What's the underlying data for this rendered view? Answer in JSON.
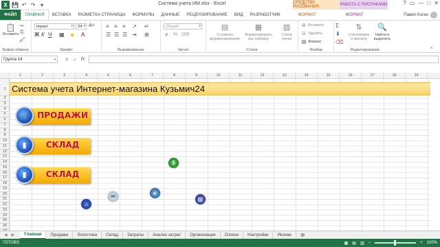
{
  "window": {
    "title": "Система учета ИМ.xlsx - Excel",
    "ctx_drawing": "СРЕДСТВА РИСОВАНИЯ",
    "ctx_picture": "РАБОТА С РИСУНКАМИ",
    "controls": [
      "?",
      "▭",
      "—",
      "□",
      "✕"
    ]
  },
  "tabs": [
    {
      "label": "ФАЙЛ"
    },
    {
      "label": "ГЛАВНАЯ"
    },
    {
      "label": "ВСТАВКА"
    },
    {
      "label": "РАЗМЕТКА СТРАНИЦЫ"
    },
    {
      "label": "ФОРМУЛЫ"
    },
    {
      "label": "ДАННЫЕ"
    },
    {
      "label": "РЕЦЕНЗИРОВАНИЕ"
    },
    {
      "label": "ВИД"
    },
    {
      "label": "РАЗРАБОТЧИК"
    },
    {
      "label": "ФОРМАТ"
    },
    {
      "label": "ФОРМАТ"
    }
  ],
  "user": "Павел Коган",
  "ribbon": {
    "clipboard": {
      "label": "Буфер обмена",
      "paste": "Вставить"
    },
    "font": {
      "label": "Шрифт",
      "name": "Impact",
      "size": "24"
    },
    "alignment": {
      "label": "Выравнивание"
    },
    "number": {
      "label": "Число",
      "format": "Общий"
    },
    "styles": {
      "label": "Стили",
      "cond": "Условное форматирование",
      "astable": "Форматировать как таблицу",
      "cellstyles": "Стили ячеек"
    },
    "cells": {
      "label": "Ячейки",
      "insert": "Вставить",
      "delete": "Удалить",
      "format": "Формат"
    },
    "editing": {
      "label": "Редактирование",
      "sort": "Сортировка и фильтр",
      "find": "Найти и выделить"
    }
  },
  "formula_bar": {
    "namebox": "Группа 14",
    "fx": "fx",
    "value": ""
  },
  "columns": [
    "1",
    "2",
    "3",
    "4",
    "5",
    "6",
    "7",
    "8",
    "9",
    "10",
    "11",
    "12",
    "13",
    "14",
    "15",
    "16",
    "17",
    "18",
    "19"
  ],
  "rows": [
    "1",
    "2",
    "3",
    "4",
    "5",
    "6",
    "7",
    "8",
    "9",
    "10",
    "11",
    "12",
    "13",
    "14",
    "15",
    "16",
    "17",
    "18",
    "19",
    "20",
    "21",
    "22",
    "23",
    "24",
    "25",
    "26",
    "27"
  ],
  "banner": "Система учета Интернет-магазина Кузьмич24",
  "buttons": [
    {
      "label": "ПРОДАЖИ",
      "icon": "cart-icon"
    },
    {
      "label": "СКЛАД",
      "icon": "box-icon"
    },
    {
      "label": "СКЛАД",
      "icon": "box-icon"
    }
  ],
  "sheet_tabs": [
    "Главная",
    "Продажи",
    "Логистика",
    "Склад",
    "Затраты",
    "Анализ затрат",
    "Организации",
    "Списки",
    "Настройки",
    "Иконки"
  ],
  "status": {
    "ready": "ГОТОВО",
    "zoom": "100%"
  },
  "colors": {
    "excel_green": "#217346",
    "button_gold": "#f5a800",
    "label_red": "#c8102e"
  }
}
